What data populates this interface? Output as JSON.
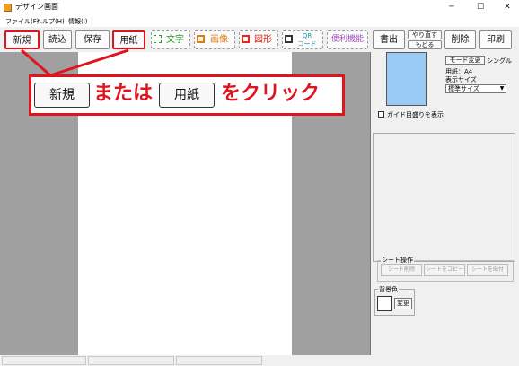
{
  "window": {
    "title": "デザイン画面",
    "minimize_icon": "─",
    "maximize_icon": "☐",
    "close_icon": "✕"
  },
  "menu": [
    "ファイル(F)",
    "ヘルプ(H)",
    "情報(I)"
  ],
  "toolbar": {
    "new": "新規",
    "open": "読込",
    "save": "保存",
    "paper": "用紙",
    "text": "文字",
    "image": "画像",
    "shape": "図形",
    "qr_line1": "QR",
    "qr_line2": "コード",
    "tools": "便利機能",
    "export": "書出",
    "redo": "やり直す",
    "undo": "もどる",
    "delete": "削除",
    "print": "印刷"
  },
  "callout": {
    "btn1": "新規",
    "middle": "または",
    "btn2": "用紙",
    "tail": "をクリック"
  },
  "right_panel": {
    "mode_button": "モード変更",
    "mode_value": "シングル",
    "paper_label": "用紙：A4",
    "display_size_label": "表示サイズ",
    "display_size_value": "標準サイズ",
    "guide_checkbox": "ガイド目盛りを表示",
    "sheet_group": "シート操作",
    "sheet_delete": "シート削除",
    "sheet_copy": "シートをコピー",
    "sheet_paste": "シートを貼付",
    "bg_label": "背景色",
    "bg_change": "変更"
  },
  "colors": {
    "accent": "#e0141e",
    "preview": "#99c9f5"
  }
}
